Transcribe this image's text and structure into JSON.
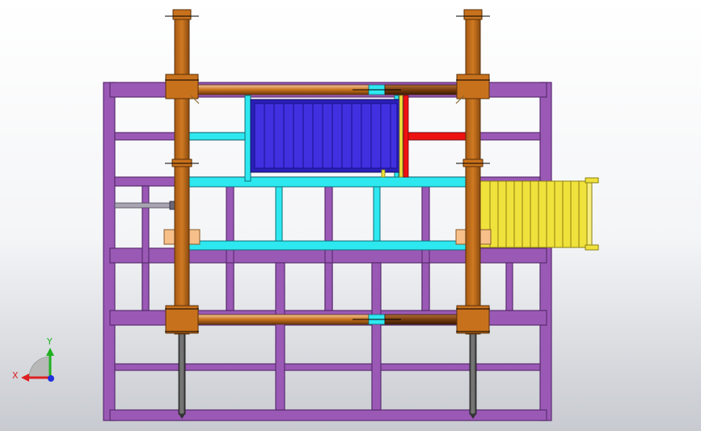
{
  "viewport": {
    "background": "gradient-grey"
  },
  "colors": {
    "frame": "#9b59b6",
    "frame_dark": "#5a2d70",
    "column": "#c8711c",
    "column_dark": "#6b3a0c",
    "cyan": "#2ee8f0",
    "blue": "#3b28d4",
    "red": "#ee1111",
    "yellow": "#f0e23c",
    "peach": "#f7c08a",
    "grey_rod": "#a8a4b2"
  },
  "triad": {
    "x_label": "X",
    "y_label": "Y",
    "x_color": "#dd2020",
    "y_color": "#20b020",
    "z_color": "#2030dd"
  }
}
